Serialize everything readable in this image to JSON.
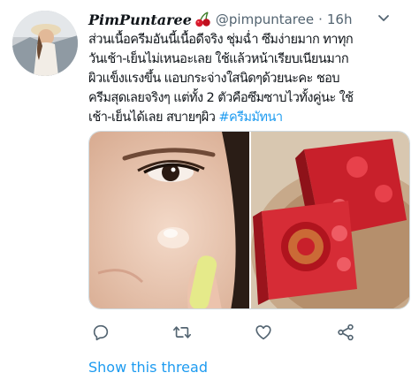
{
  "tweet": {
    "author": {
      "display_name": "PimPuntaree",
      "handle": "@pimpuntaree",
      "avatar_icon": "avatar-woman-with-hat"
    },
    "separator": "·",
    "time": "16h",
    "more_icon": "chevron-down-icon",
    "text_lines": [
      "ส่วนเนื้อครีมอันนี้เนื้อดีจริง ชุ่มฉ่ำ ซึมง่ายมาก ทาทุก",
      "วันเช้า-เย็นไม่เหนอะเลย ใช้แล้วหน้าเรียบเนียนมาก",
      "ผิวแข็งแรงขึ้น แอบกระจ่างใสนิดๆด้วยนะคะ ชอบ",
      "ครีมสุดเลยจริงๆ แต่ทั้ง 2 ตัวคือซึมซาบไวทั้งคู่นะ ใช้",
      "เช้า-เย็นได้เลย สบายๆผิว "
    ],
    "hashtag": "#ครีมมัทนา",
    "media": [
      {
        "description_icon": "face-closeup-photo"
      },
      {
        "description_icon": "red-rose-cream-box-photo"
      }
    ],
    "actions": {
      "reply_icon": "reply-icon",
      "retweet_icon": "retweet-icon",
      "like_icon": "heart-icon",
      "share_icon": "share-icon"
    },
    "show_thread": "Show this thread",
    "colors": {
      "accent": "#1d9bf0",
      "secondary_text": "#536471",
      "primary_text": "#0f1419",
      "box_red": "#c8202b"
    }
  }
}
